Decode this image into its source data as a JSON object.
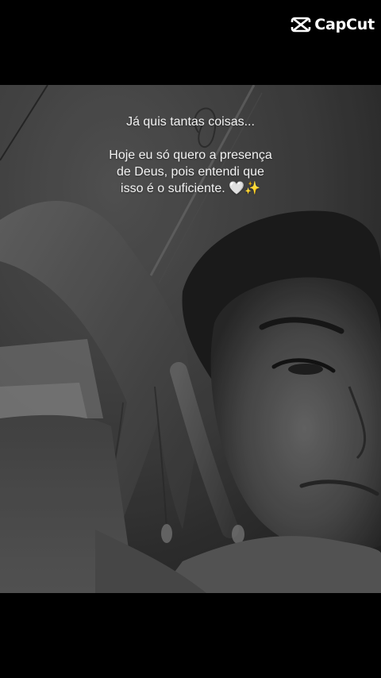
{
  "watermark": {
    "text": "CapCut",
    "icon": "capcut-logo-icon"
  },
  "caption": {
    "line1": "Já quis tantas coisas...",
    "line2": "Hoje eu só quero a presença",
    "line3": "de Deus, pois entendi que",
    "line4_text": "isso é o suficiente.",
    "line4_emoji_heart": "🤍",
    "line4_emoji_sparkles": "✨"
  },
  "photo": {
    "subject": "grayscale selfie photo",
    "tone": "#3a3a3a"
  },
  "colors": {
    "background": "#000000",
    "caption_text": "#f2f2f2",
    "watermark": "#ffffff"
  }
}
